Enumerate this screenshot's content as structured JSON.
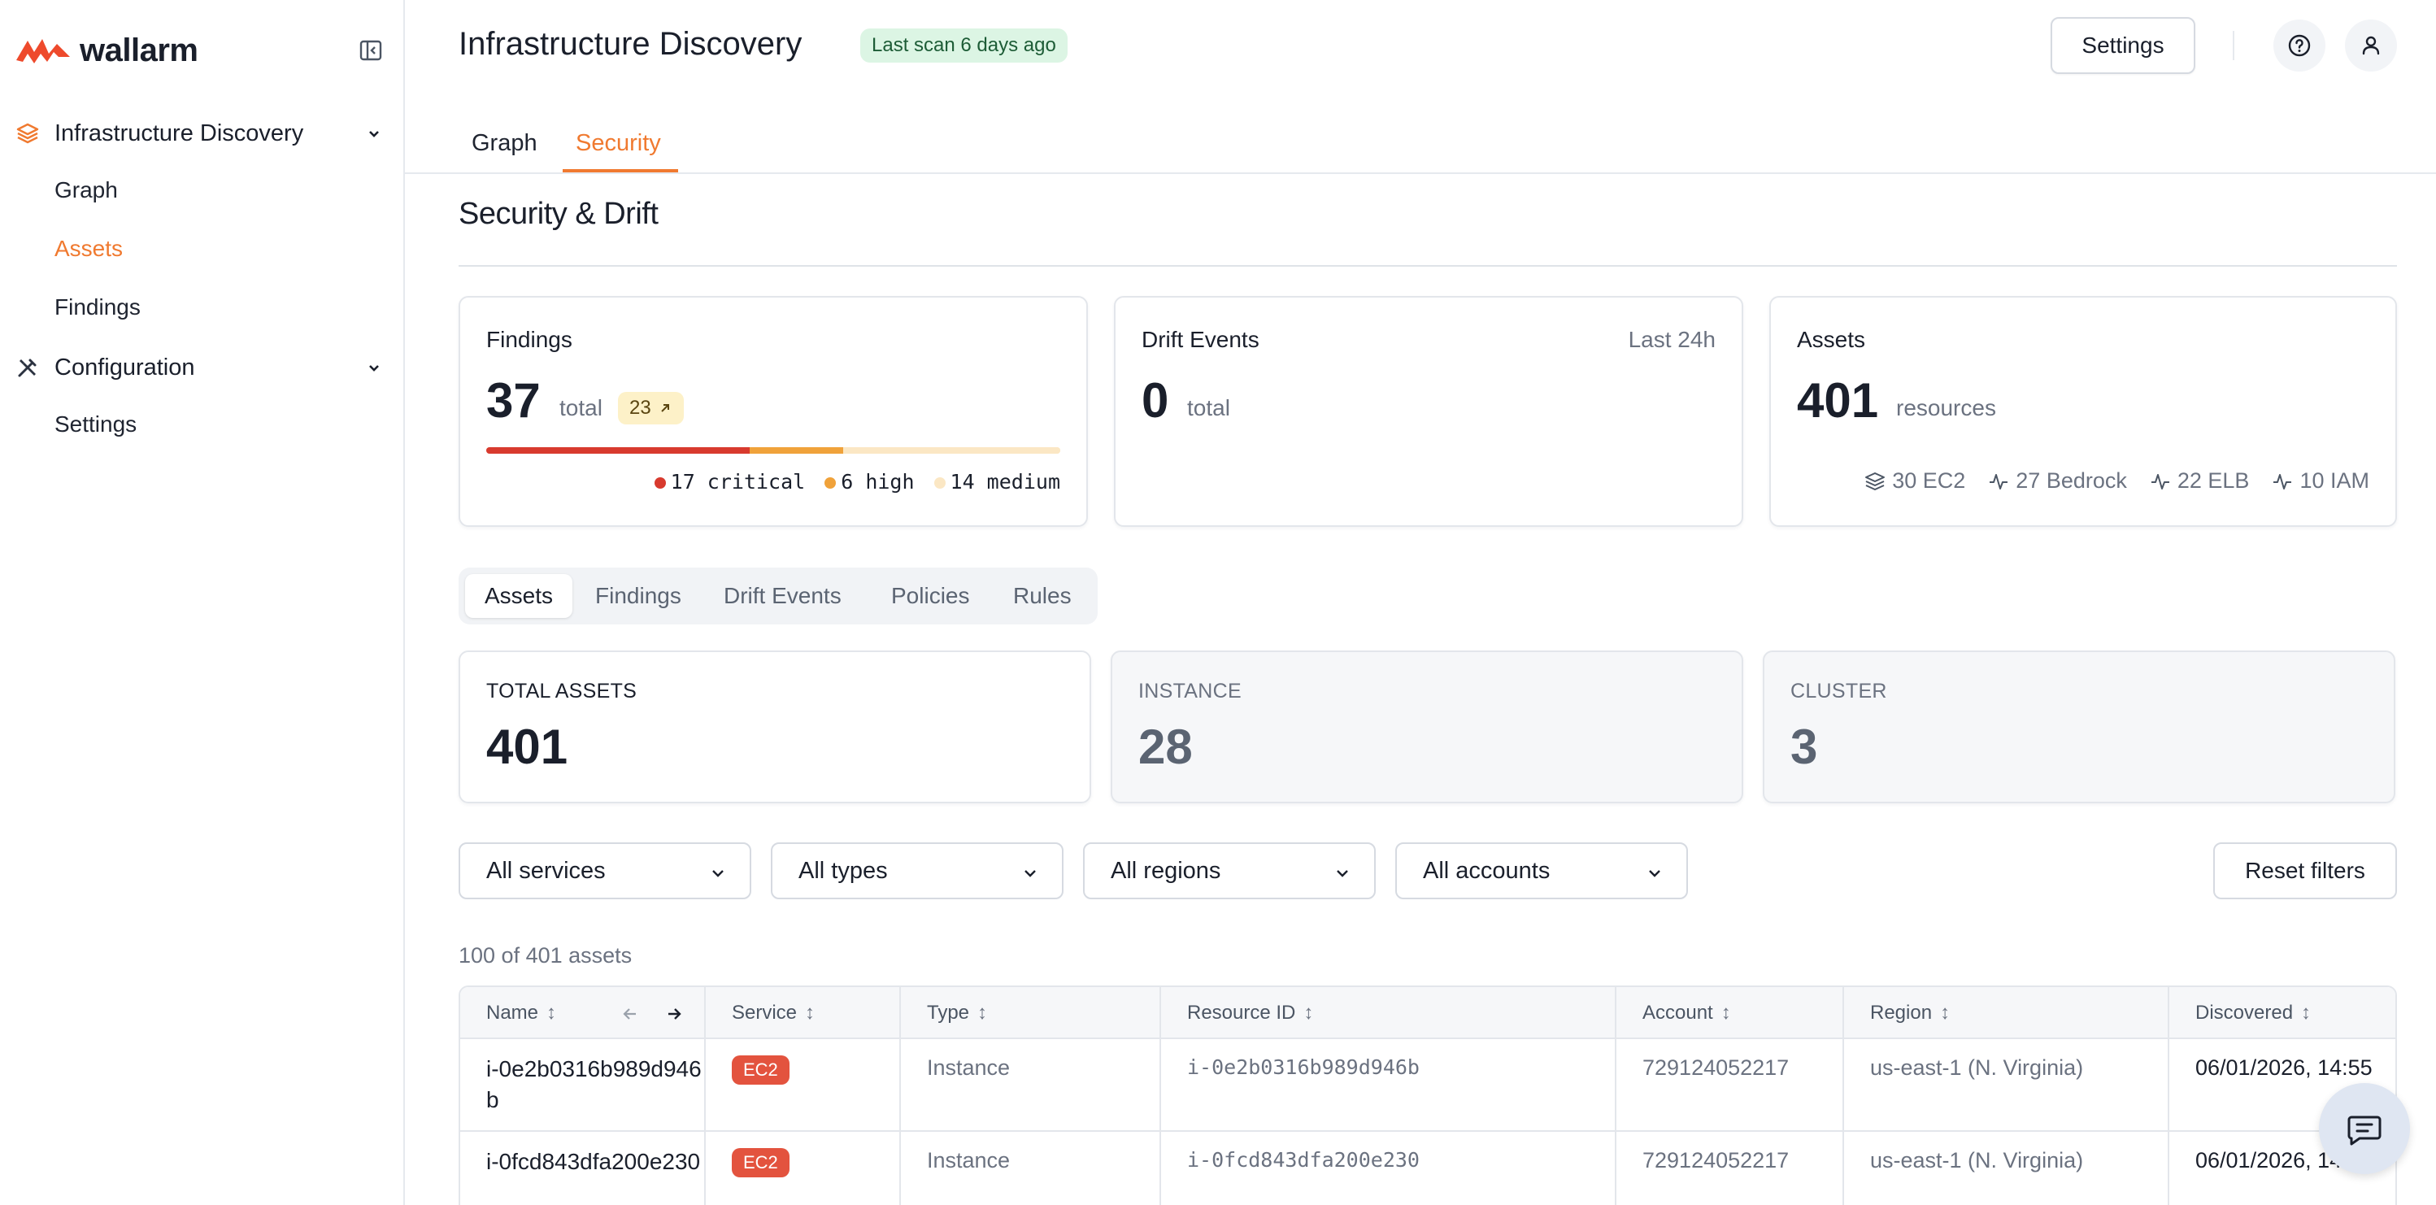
{
  "app": {
    "logo_text": "wallarm",
    "brand_color": "#f07a30"
  },
  "sidebar": {
    "groups": [
      {
        "label": "Infrastructure Discovery",
        "icon": "layers-icon",
        "items": [
          {
            "label": "Graph",
            "active": false
          },
          {
            "label": "Assets",
            "active": true
          },
          {
            "label": "Findings",
            "active": false
          }
        ]
      },
      {
        "label": "Configuration",
        "icon": "tools-icon",
        "items": [
          {
            "label": "Settings",
            "active": false
          }
        ]
      }
    ]
  },
  "header": {
    "title": "Infrastructure Discovery",
    "scan_badge": "Last scan 6 days ago",
    "settings_label": "Settings",
    "help_icon": "help-circle-icon",
    "user_icon": "user-icon"
  },
  "tabs": [
    {
      "label": "Graph",
      "active": false
    },
    {
      "label": "Security",
      "active": true
    }
  ],
  "section": {
    "title": "Security & Drift"
  },
  "stats": {
    "findings": {
      "label": "Findings",
      "total": "37",
      "unit": "total",
      "trend": "23",
      "severity": [
        {
          "label": "17 critical",
          "count": 17,
          "color": "#d83a2e"
        },
        {
          "label": "6 high",
          "count": 6,
          "color": "#f0a23a"
        },
        {
          "label": "14 medium",
          "count": 14,
          "color": "#fbe7c4"
        }
      ]
    },
    "drift": {
      "label": "Drift Events",
      "period": "Last 24h",
      "total": "0",
      "unit": "total"
    },
    "assets": {
      "label": "Assets",
      "total": "401",
      "unit": "resources",
      "types": [
        {
          "label": "30 EC2",
          "icon": "layers-icon"
        },
        {
          "label": "27 Bedrock",
          "icon": "activity-icon"
        },
        {
          "label": "22 ELB",
          "icon": "activity-icon"
        },
        {
          "label": "10 IAM",
          "icon": "activity-icon"
        }
      ]
    }
  },
  "subtabs": [
    {
      "label": "Assets",
      "active": true
    },
    {
      "label": "Findings",
      "active": false
    },
    {
      "label": "Drift Events",
      "active": false
    },
    {
      "label": "Policies",
      "active": false
    },
    {
      "label": "Rules",
      "active": false
    }
  ],
  "counts": [
    {
      "label": "TOTAL ASSETS",
      "value": "401"
    },
    {
      "label": "INSTANCE",
      "value": "28"
    },
    {
      "label": "CLUSTER",
      "value": "3"
    }
  ],
  "filters": {
    "services": "All services",
    "types": "All types",
    "regions": "All regions",
    "accounts": "All accounts",
    "reset_label": "Reset filters"
  },
  "table": {
    "count_text": "100 of 401 assets",
    "columns": [
      "Name",
      "Service",
      "Type",
      "Resource ID",
      "Account",
      "Region",
      "Discovered"
    ],
    "rows": [
      {
        "name": "i-0e2b0316b989d946b",
        "service": "EC2",
        "type": "Instance",
        "resource_id": "i-0e2b0316b989d946b",
        "account": "729124052217",
        "region": "us-east-1 (N. Virginia)",
        "discovered": "06/01/2026, 14:55"
      },
      {
        "name": "i-0fcd843dfa200e230",
        "service": "EC2",
        "type": "Instance",
        "resource_id": "i-0fcd843dfa200e230",
        "account": "729124052217",
        "region": "us-east-1 (N. Virginia)",
        "discovered": "06/01/2026, 14:55"
      }
    ]
  }
}
